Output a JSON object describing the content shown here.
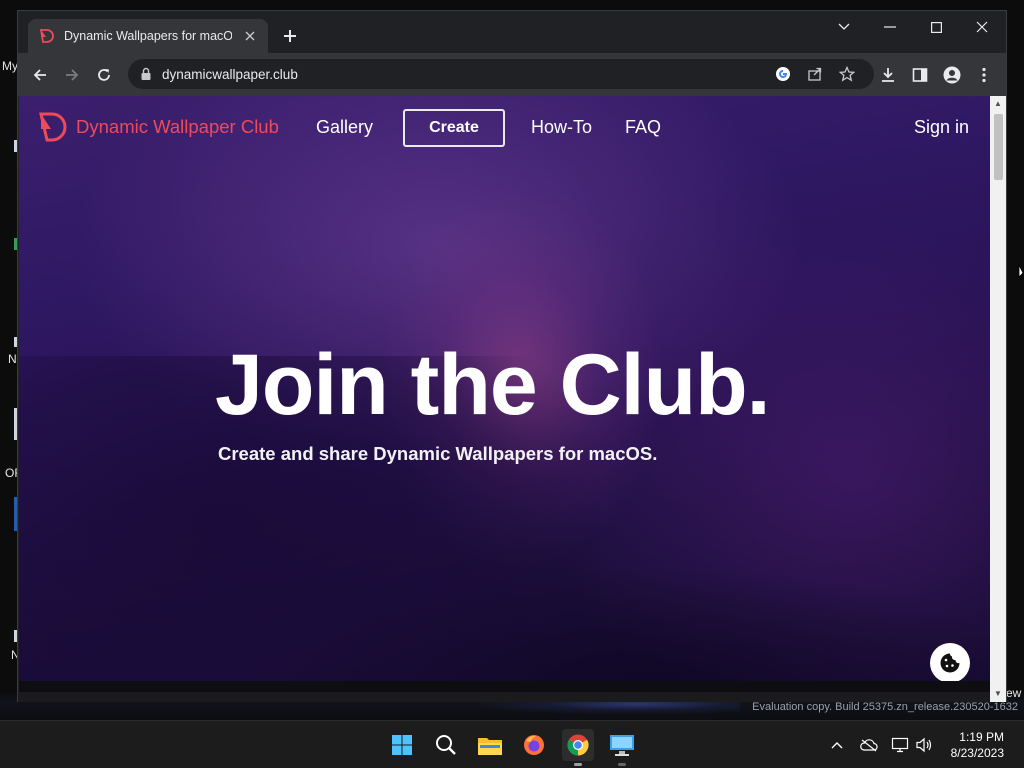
{
  "desktop": {
    "fragments": [
      "My",
      "N",
      "OF",
      "N",
      "ew"
    ]
  },
  "browser": {
    "tab": {
      "title": "Dynamic Wallpapers for macOS",
      "close_icon": "close-icon",
      "new_tab_icon": "plus-icon"
    },
    "window_controls": [
      "chevron-down-icon",
      "minimize-icon",
      "maximize-icon",
      "close-icon"
    ],
    "toolbar": {
      "url": "dynamicwallpaper.club",
      "icons": [
        "back-arrow-icon",
        "forward-arrow-icon",
        "reload-icon",
        "lock-icon",
        "google-icon",
        "share-icon",
        "star-icon",
        "download-icon",
        "side-panel-icon",
        "profile-icon",
        "kebab-menu-icon"
      ]
    }
  },
  "site": {
    "brand": "Dynamic Wallpaper Club",
    "nav": {
      "gallery": "Gallery",
      "create": "Create",
      "howto": "How-To",
      "faq": "FAQ",
      "signin": "Sign in"
    },
    "hero": {
      "title": "Join the Club.",
      "subtitle": "Create and share Dynamic Wallpapers for macOS."
    },
    "colors": {
      "brand": "#ef4a5a",
      "bg_dark": "#1d0f3e",
      "bg_purple": "#3b1f6e"
    }
  },
  "watermark": "Evaluation copy. Build 25375.zn_release.230520-1632",
  "taskbar": {
    "apps": [
      "windows-start-icon",
      "search-icon",
      "file-explorer-icon",
      "firefox-icon",
      "chrome-icon",
      "remote-desktop-icon"
    ],
    "tray": [
      "chevron-up-icon",
      "onedrive-cloud-icon",
      "network-icon",
      "volume-icon"
    ],
    "time": "1:19 PM",
    "date": "8/23/2023"
  }
}
